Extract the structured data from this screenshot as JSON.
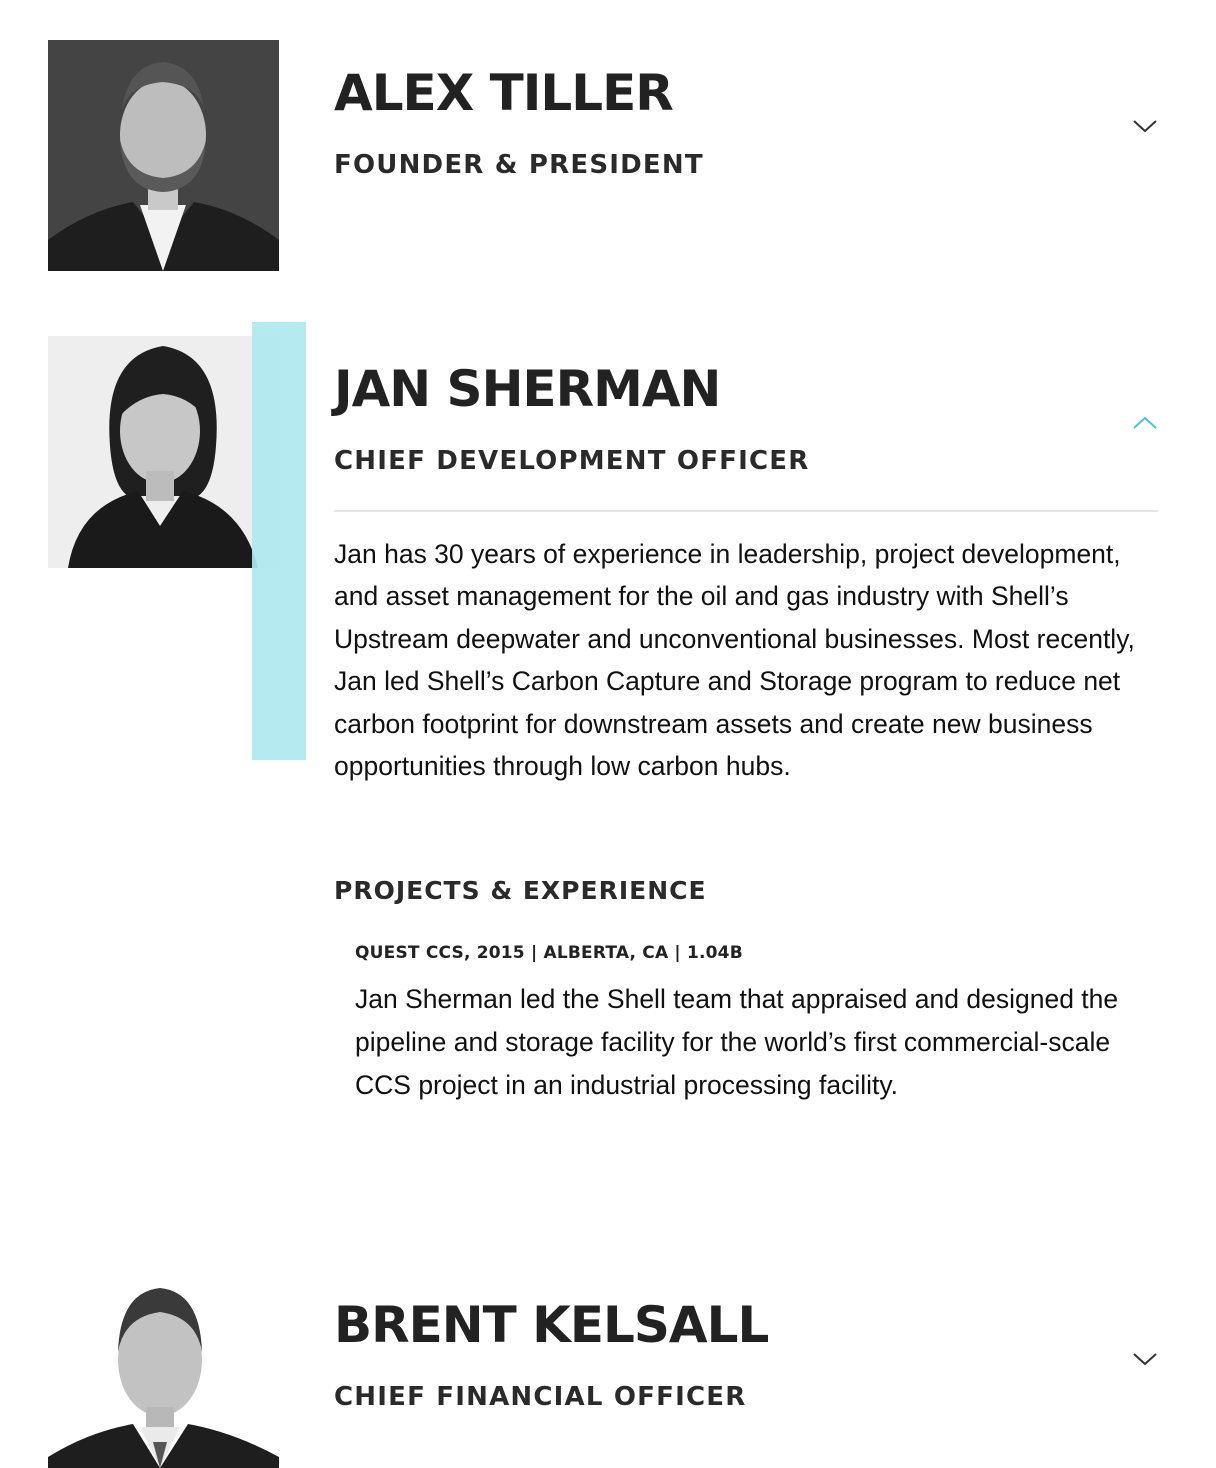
{
  "team": [
    {
      "name": "ALEX TILLER",
      "role": "FOUNDER & PRESIDENT",
      "expanded": false,
      "photo": "portrait-photo"
    },
    {
      "name": "JAN SHERMAN",
      "role": "CHIEF DEVELOPMENT OFFICER",
      "expanded": true,
      "photo": "portrait-photo",
      "bio": "Jan has 30 years of experience in leadership, project development, and asset management for the oil and gas industry with Shell’s Upstream deepwater and unconventional businesses. Most recently, Jan led Shell’s Carbon Capture and Storage program to reduce net carbon footprint for downstream assets and create new business opportunities through low carbon hubs.",
      "projects_heading": "PROJECTS & EXPERIENCE",
      "projects": [
        {
          "meta": "QUEST CCS, 2015 | ALBERTA, CA | 1.04B",
          "description": "Jan Sherman led the Shell team that appraised and designed the pipeline and storage facility for the world’s first commercial-scale CCS project in an industrial processing facility."
        }
      ]
    },
    {
      "name": "BRENT KELSALL",
      "role": "CHIEF FINANCIAL OFFICER",
      "expanded": false,
      "photo": "portrait-photo"
    }
  ],
  "icons": {
    "collapsed": "chevron-down-icon",
    "expanded": "chevron-up-icon"
  },
  "colors": {
    "accent": "#aee8ef",
    "chevron_expanded": "#4fc3d6",
    "chevron_collapsed": "#333333",
    "text": "#222222"
  }
}
